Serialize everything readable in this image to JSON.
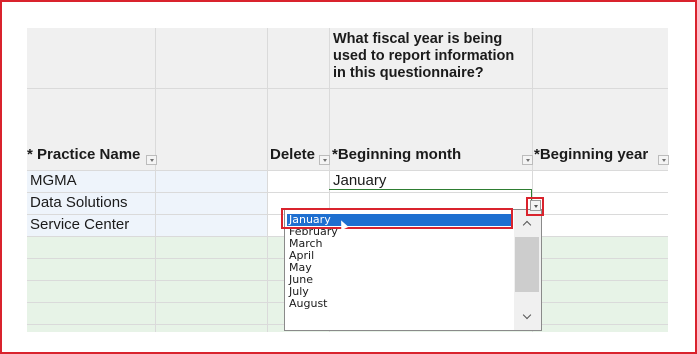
{
  "question": "What fiscal year is being used to report information in this questionnaire?",
  "headers": {
    "practice_name": "* Practice Name",
    "delete": "Delete",
    "beginning_month": "*Beginning month",
    "beginning_year": "*Beginning year"
  },
  "rows": [
    {
      "practice_name": "MGMA",
      "beginning_month": "January"
    },
    {
      "practice_name": "Data Solutions",
      "beginning_month": ""
    },
    {
      "practice_name": "Service Center",
      "beginning_month": ""
    }
  ],
  "dropdown": {
    "selected": "January",
    "options": [
      "January",
      "February",
      "March",
      "April",
      "May",
      "June",
      "July",
      "August"
    ]
  },
  "colors": {
    "highlight_border": "#d9232d",
    "selected_option": "#1e6fd0",
    "header_bg": "#f0f0f0",
    "blue_row": "#eef4fb",
    "green_row": "#e7f3e7",
    "active_cell_border": "#2e7d32"
  },
  "icons": {
    "filter": "filter-dropdown-icon",
    "dropdown_arrow": "chevron-down-icon",
    "scroll_up": "chevron-up-icon",
    "scroll_down": "chevron-down-icon",
    "cursor": "mouse-pointer-icon"
  }
}
